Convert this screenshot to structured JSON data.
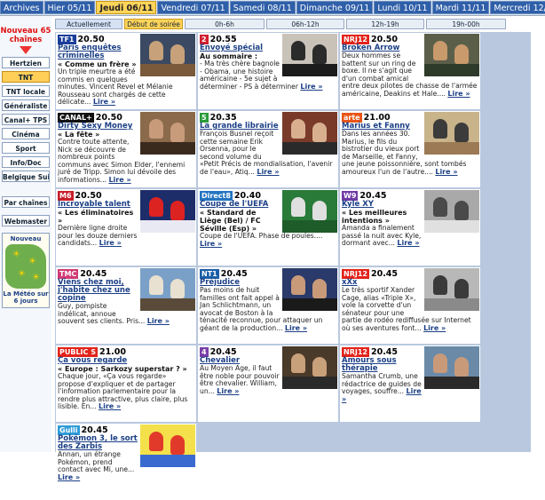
{
  "days": [
    "Archives",
    "Hier 05/11",
    "Jeudi 06/11",
    "Vendredi 07/11",
    "Samedi 08/11",
    "Dimanche 09/11",
    "Lundi 10/11",
    "Mardi 11/11",
    "Mercredi 12/11"
  ],
  "active_day_index": 2,
  "left": {
    "promo": "Nouveau 65 chaînes",
    "nav": [
      "Hertzien",
      "TNT",
      "TNT locale",
      "Généraliste",
      "Canal+ TPS",
      "Cinéma",
      "Sport",
      "Info/Doc",
      "Belgique Suisse"
    ],
    "nav2": [
      "Par chaînes",
      "Webmaster"
    ],
    "meteo_new": "Nouveau",
    "meteo_caption": "La Météo sur 6 jours"
  },
  "slots": [
    "Actuellement",
    "Début de soirée",
    "0h-6h",
    "06h-12h",
    "12h-19h",
    "19h-00h"
  ],
  "programs": [
    {
      "logo": "TF1",
      "color": "tf1",
      "time": "20.50",
      "title": "Paris enquêtes criminelles",
      "sub": "« Comme un frère »",
      "body": "Un triple meurtre a été commis en quelques minutes. Vincent Revel et Mélanie Rousseau sont chargés de cette délicate...",
      "pic": [
        "#3b4a62",
        "#c6a17a",
        "#7a5a3a"
      ]
    },
    {
      "logo": "2",
      "color": "france2",
      "time": "20.55",
      "title": "Envoyé spécial",
      "sub": "Au sommaire :",
      "body": "- Ma très chère bagnole - Obama, une histoire américaine - 5e sujet à déterminer - PS à déterminer",
      "pic": [
        "#c9c2b9",
        "#2b2b2b",
        "#1c1c1c"
      ]
    },
    {
      "logo": "NRJ12",
      "color": "nrj",
      "time": "20.50",
      "title": "Broken Arrow",
      "sub": "",
      "body": "Deux hommes se battent sur un ring de boxe. Il ne s'agit que d'un combat amical entre deux pilotes de chasse de l'armée américaine, Deakins et Hale....",
      "pic": [
        "#5b5f4a",
        "#c99a6c",
        "#2e3a2a"
      ]
    },
    {
      "logo": "CANAL+",
      "color": "canal",
      "time": "20.50",
      "title": "Dirty Sexy Money",
      "sub": "« La fête »",
      "body": "Contre toute attente, Nick se découvre de nombreux points communs avec Simon Elder, l'ennemi juré de Tripp. Simon lui dévoile des informations...",
      "pic": [
        "#8a6a4a",
        "#c89b7a",
        "#3a2a1e"
      ]
    },
    {
      "logo": "5",
      "color": "france5",
      "time": "20.35",
      "title": "La grande librairie",
      "sub": "",
      "body": "François Busnel reçoit cette semaine Erik Orsenna, pour le second volume du «Petit Précis de mondialisation, l'avenir de l'eau», Atiq...",
      "pic": [
        "#7a3a2a",
        "#d8b090",
        "#2a2a2a"
      ]
    },
    {
      "logo": "arte",
      "color": "arte",
      "time": "21.00",
      "title": "Marius et Fanny",
      "sub": "",
      "body": "Dans les années 30. Marius, le fils du bistrotier du vieux port de Marseille, et Fanny, une jeune poissonnière, sont tombés amoureux l'un de l'autre....",
      "pic": [
        "#c8b38a",
        "#3b3b3b",
        "#9b7a55"
      ]
    },
    {
      "logo": "M6",
      "color": "m6",
      "time": "20.50",
      "title": "Incroyable talent",
      "sub": "« Les éliminatoires »",
      "body": "Dernière ligne droite pour les douze derniers candidats...",
      "pic": [
        "#1c2d6a",
        "#d22",
        "#e9e9f3"
      ]
    },
    {
      "logo": "Direct8",
      "color": "direct",
      "time": "20.40",
      "title": "Coupe de l'UEFA",
      "sub": "« Standard de Liège (Bel) / FC Séville (Esp) »",
      "body": "Coupe de l'UEFA. Phase de poules....",
      "pic": [
        "#2a7a3a",
        "#e0e0e0",
        "#1e5c2a"
      ]
    },
    {
      "logo": "W9",
      "color": "w9",
      "time": "20.45",
      "title": "Kyle XY",
      "sub": "« Les meilleures intentions »",
      "body": "Amanda a finalement passé la nuit avec Kyle, dormant avec...",
      "pic": [
        "#a9a9a9",
        "#4a4a4a",
        "#e0e0e0"
      ]
    },
    {
      "logo": "TMC",
      "color": "tmc",
      "time": "20.45",
      "title": "Viens chez moi, j'habite chez une copine",
      "sub": "",
      "body": "Guy, pompiste indélicat, annoue souvent ses clients. Pris...",
      "pic": [
        "#7aa0c8",
        "#e8e0d0",
        "#5a4a3a"
      ]
    },
    {
      "logo": "NT1",
      "color": "nt1",
      "time": "20.45",
      "title": "Préjudice",
      "sub": "",
      "body": "Pas moins de huit familles ont fait appel à Jan Schlichtmann, un avocat de Boston à la ténacité reconnue, pour attaquer un géant de la production...",
      "pic": [
        "#2a3a6a",
        "#c89a7a",
        "#1a1a1a"
      ]
    },
    {
      "logo": "NRJ12",
      "color": "nrj",
      "time": "20.45",
      "title": "xXx",
      "sub": "",
      "body": "Le très sportif Xander Cage, alias «Triple X», vole la corvette d'un sénateur pour une partie de rodéo rediffusée sur Internet où ses aventures font...",
      "pic": [
        "#b8b8b8",
        "#3a3a3a",
        "#8a8a8a"
      ]
    },
    {
      "logo": "PUBLIC S",
      "color": "public",
      "time": "21.00",
      "title": "Ça vous regarde",
      "sub": "« Europe : Sarkozy superstar ? »",
      "body": "Chaque jour, «Ça vous regarde» propose d'expliquer et de partager l'information parlementaire pour la rendre plus attractive, plus claire, plus lisible. En...",
      "pic": null
    },
    {
      "logo": "4",
      "color": "france4",
      "time": "20.45",
      "title": "Chevalier",
      "sub": "",
      "body": "Au Moyen Age, il faut être noble pour pouvoir être chevalier. William, un...",
      "pic": [
        "#4a3a2a",
        "#c8a07a",
        "#2a2a2a"
      ]
    },
    {
      "logo": "NRJ12",
      "color": "nrj",
      "time": "20.45",
      "title": "Amours sous thérapie",
      "sub": "",
      "body": "Samantha Crumb, une rédactrice de guides de voyages, souffre...",
      "pic": [
        "#6a8aa8",
        "#c89a7a",
        "#2a2a2a"
      ]
    },
    {
      "logo": "Gulli",
      "color": "gulli",
      "time": "20.45",
      "title": "Pokémon 3, le sort des Zarbis",
      "sub": "",
      "body": "Annan, un étrange Pokémon, prend contact avec Mi, une...",
      "pic": [
        "#f4e04a",
        "#e23a2a",
        "#3a6ad0"
      ]
    }
  ],
  "lire": "Lire »"
}
